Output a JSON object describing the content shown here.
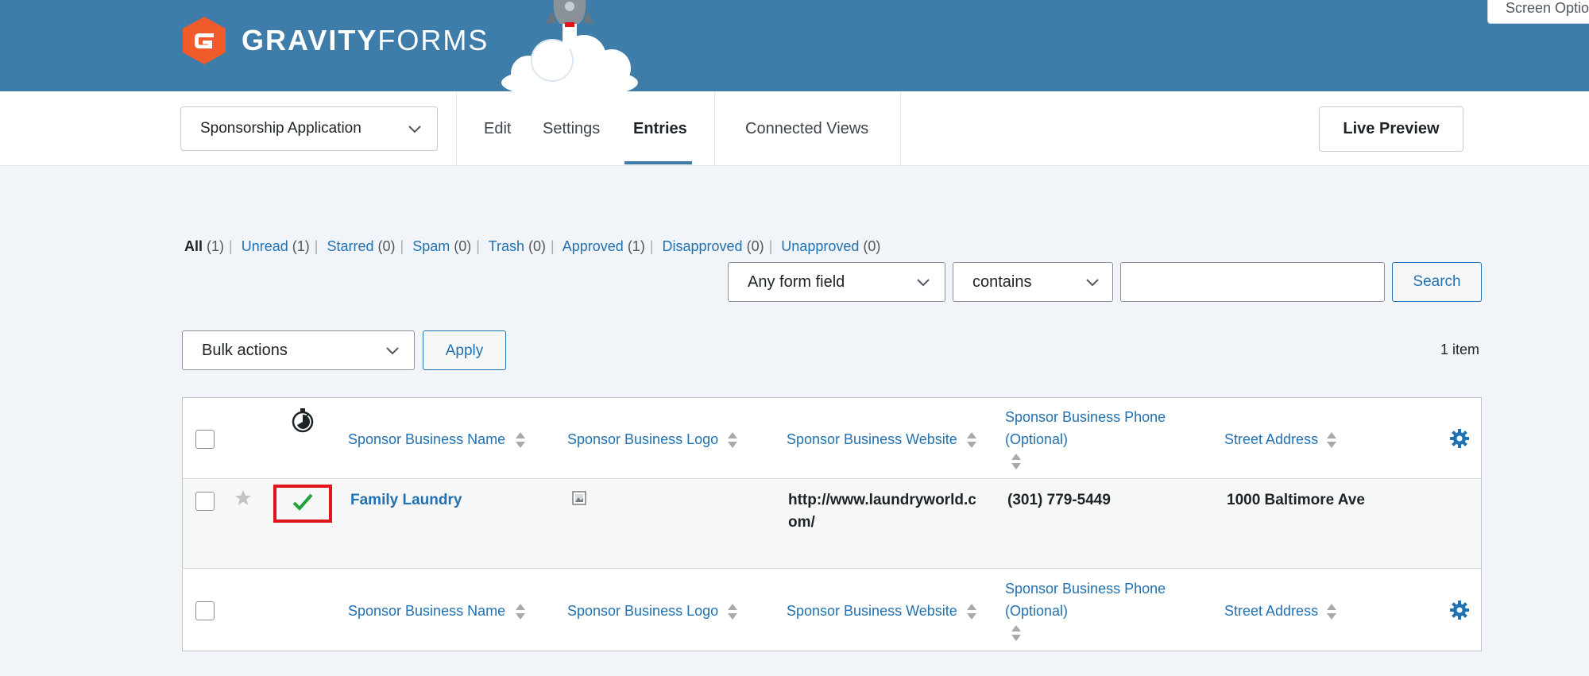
{
  "brand": {
    "word1": "GRAVITY",
    "word2": "FORMS"
  },
  "screen_options": "Screen Options",
  "toolbar": {
    "form_name": "Sponsorship Application",
    "tabs": {
      "edit": "Edit",
      "settings": "Settings",
      "entries": "Entries",
      "connected_views": "Connected Views"
    },
    "live_preview": "Live Preview"
  },
  "filters": [
    {
      "label": "All",
      "count": "(1)"
    },
    {
      "label": "Unread",
      "count": "(1)"
    },
    {
      "label": "Starred",
      "count": "(0)"
    },
    {
      "label": "Spam",
      "count": "(0)"
    },
    {
      "label": "Trash",
      "count": "(0)"
    },
    {
      "label": "Approved",
      "count": "(1)"
    },
    {
      "label": "Disapproved",
      "count": "(0)"
    },
    {
      "label": "Unapproved",
      "count": "(0)"
    }
  ],
  "search": {
    "field": "Any form field",
    "operator": "contains",
    "value": "",
    "button": "Search"
  },
  "bulk": {
    "label": "Bulk actions",
    "apply": "Apply"
  },
  "item_count": "1 item",
  "columns": {
    "name": "Sponsor Business Name",
    "logo": "Sponsor Business Logo",
    "website": "Sponsor Business Website",
    "phone_line1": "Sponsor Business Phone",
    "phone_line2": "(Optional)",
    "address": "Street Address"
  },
  "entry": {
    "name": "Family Laundry",
    "website_line1": "http://www.laundryworld.c",
    "website_line2": "om/",
    "phone": "(301) 779-5449",
    "address": "1000 Baltimore Ave",
    "approved": true
  },
  "colors": {
    "header": "#3e7ca9",
    "link": "#2271b1",
    "approved_check": "#22a33a",
    "highlight": "#e1141b"
  }
}
